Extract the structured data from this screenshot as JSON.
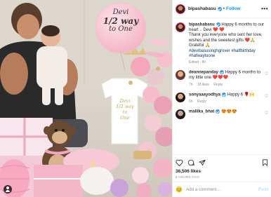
{
  "post": {
    "username": "bipashabasu",
    "follow_label": "Follow",
    "more_label": "•••",
    "caption_lines": [
      "Happy 6 months to our heart .. Devi ❤️ ❤️",
      "Thank you everyone who sent her love, wishes and the sweetest gifts ❤️🙏",
      "Grateful 🙏"
    ],
    "hashtags": "#devibasusinghgrover #halfbirthday #hafwaytoone",
    "caption_meta": "Edited · 8h",
    "balloon_lines": [
      "Devi",
      "1/2 way",
      "to One"
    ],
    "onesie_lines": [
      "Devi",
      "1/2 way",
      "to",
      "One"
    ]
  },
  "comments": [
    {
      "username": "deannepanday",
      "text": "Happy 6 months to my little one ❤️❤️❤️",
      "time": "7h",
      "likes": "18 likes",
      "reply": "Reply"
    },
    {
      "username": "sonyaaayodhya",
      "text": "Happy 6 🌹🙌",
      "time": "6h",
      "likes": "",
      "reply": "Reply"
    },
    {
      "username": "mallika_bhat",
      "text": "😍😍😍",
      "time": "",
      "likes": "",
      "reply": ""
    }
  ],
  "engagement": {
    "likes": "36,506 likes",
    "time_ago": "8 HOURS AGO"
  },
  "composer": {
    "emoji": "😊",
    "placeholder": "Add a comment…",
    "post_label": "Post"
  },
  "colors": {
    "accent": "#0095f6",
    "verified": "#3897f0",
    "heart": "#ed4956"
  }
}
